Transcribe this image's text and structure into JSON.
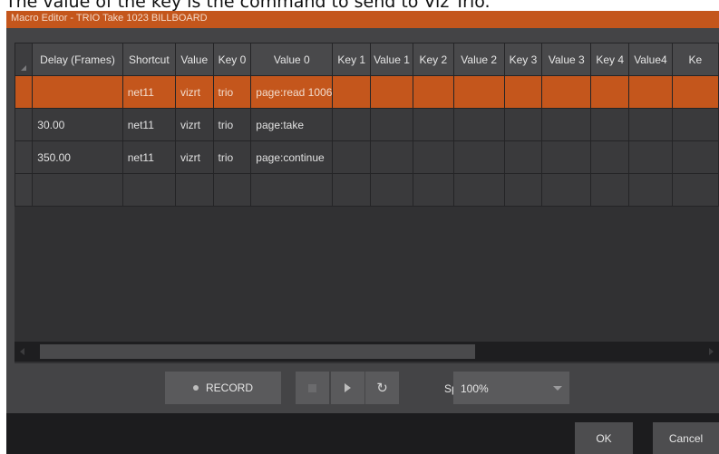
{
  "caption": {
    "text": "The value of the key is the command to send to Viz Trio."
  },
  "window": {
    "title": "Macro Editor - TRIO Take 1023 BILLBOARD"
  },
  "grid": {
    "columns": [
      "Delay (Frames)",
      "Shortcut",
      "Value",
      "Key 0",
      "Value 0",
      "Key 1",
      "Value 1",
      "Key 2",
      "Value 2",
      "Key 3",
      "Value 3",
      "Key 4",
      "Value4",
      "Ke"
    ],
    "rows": [
      [
        "",
        "net11",
        "vizrt",
        "trio",
        "page:read 1006",
        "",
        "",
        "",
        "",
        "",
        "",
        "",
        "",
        ""
      ],
      [
        "30.00",
        "net11",
        "vizrt",
        "trio",
        "page:take",
        "",
        "",
        "",
        "",
        "",
        "",
        "",
        "",
        ""
      ],
      [
        "350.00",
        "net11",
        "vizrt",
        "trio",
        "page:continue",
        "",
        "",
        "",
        "",
        "",
        "",
        "",
        "",
        ""
      ],
      [
        "",
        "",
        "",
        "",
        "",
        "",
        "",
        "",
        "",
        "",
        "",
        "",
        "",
        ""
      ]
    ],
    "selected_row": 0
  },
  "controls": {
    "record_label": "RECORD",
    "stop_icon": "stop-icon",
    "play_icon": "play-icon",
    "loop_icon": "loop-icon",
    "loop_glyph": "↻",
    "speed_label": "Speed",
    "speed_value": "100%"
  },
  "footer": {
    "ok_label": "OK",
    "cancel_label": "Cancel"
  },
  "colors": {
    "accent": "#c4561c",
    "window_bg": "#444446",
    "grid_bg": "#313133",
    "button_bg": "#5a5a5c",
    "footer_bg": "#1c1c1e"
  }
}
